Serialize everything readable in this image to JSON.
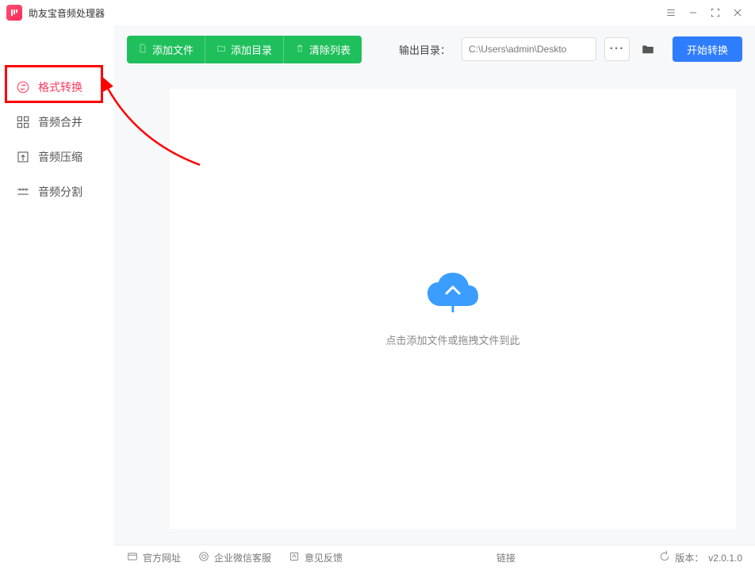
{
  "app": {
    "title": "助友宝音频处理器"
  },
  "sidebar": {
    "items": [
      {
        "label": "格式转换"
      },
      {
        "label": "音频合并"
      },
      {
        "label": "音频压缩"
      },
      {
        "label": "音频分割"
      }
    ]
  },
  "toolbar": {
    "add_file": "添加文件",
    "add_folder": "添加目录",
    "clear_list": "清除列表",
    "output_label": "输出目录：",
    "output_path": "C:\\Users\\admin\\Deskto",
    "more": "···",
    "start": "开始转换"
  },
  "dropzone": {
    "text": "点击添加文件或拖拽文件到此"
  },
  "footer": {
    "official_site": "官方网址",
    "wechat_support": "企业微信客服",
    "feedback": "意见反馈",
    "link": "链接",
    "version_label": "版本：",
    "version_value": "v2.0.1.0"
  }
}
